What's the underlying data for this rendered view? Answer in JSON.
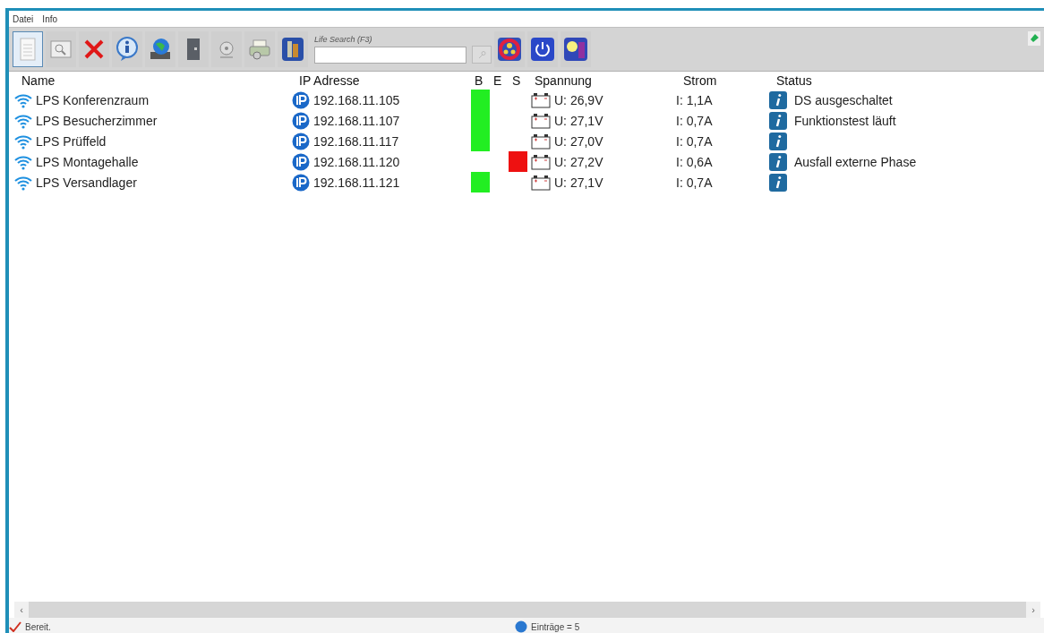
{
  "menu": [
    "Datei",
    "Info"
  ],
  "toolbar": {
    "buttons": [
      {
        "kind": "document",
        "pressed": true
      },
      {
        "kind": "preview",
        "pressed": false
      },
      {
        "kind": "delete",
        "pressed": false
      },
      {
        "kind": "info",
        "pressed": false
      },
      {
        "kind": "network",
        "pressed": false
      },
      {
        "kind": "device",
        "pressed": false
      },
      {
        "kind": "disc",
        "pressed": false
      },
      {
        "kind": "printer",
        "pressed": false
      },
      {
        "kind": "book",
        "pressed": false
      }
    ],
    "search": {
      "label": "Life Search (F3)"
    },
    "actions": [
      {
        "kind": "alarm"
      },
      {
        "kind": "power"
      },
      {
        "kind": "lamp"
      }
    ]
  },
  "table": {
    "columns": [
      "Name",
      "IP Adresse",
      "B",
      "E",
      "S",
      "Spannung",
      "Strom",
      "Status"
    ],
    "rows": [
      {
        "name": "LPS  Konferenzraum",
        "ip": "192.168.11.105",
        "b": true,
        "e": false,
        "s": false,
        "voltage": "U: 26,9V",
        "current": "I: 1,1A",
        "status": "DS ausgeschaltet"
      },
      {
        "name": "LPS Besucherzimmer",
        "ip": "192.168.11.107",
        "b": true,
        "e": false,
        "s": false,
        "voltage": "U: 27,1V",
        "current": "I: 0,7A",
        "status": "Funktionstest läuft"
      },
      {
        "name": "LPS Prüffeld",
        "ip": "192.168.11.117",
        "b": true,
        "e": false,
        "s": false,
        "voltage": "U: 27,0V",
        "current": "I: 0,7A"
      },
      {
        "name": "LPS Montagehalle",
        "ip": "192.168.11.120",
        "b": false,
        "e": false,
        "s": true,
        "voltage": "U: 27,2V",
        "current": "I: 0,6A",
        "status": "Ausfall externe Phase"
      },
      {
        "name": "LPS Versandlager",
        "ip": "192.168.11.121",
        "b": true,
        "e": false,
        "s": false,
        "voltage": "U: 27,1V",
        "current": "I: 0,7A"
      }
    ]
  },
  "scrollbar": {
    "left": "‹",
    "right": "›"
  },
  "status_bar": {
    "left": "Bereit.",
    "right": "Einträge = 5"
  }
}
